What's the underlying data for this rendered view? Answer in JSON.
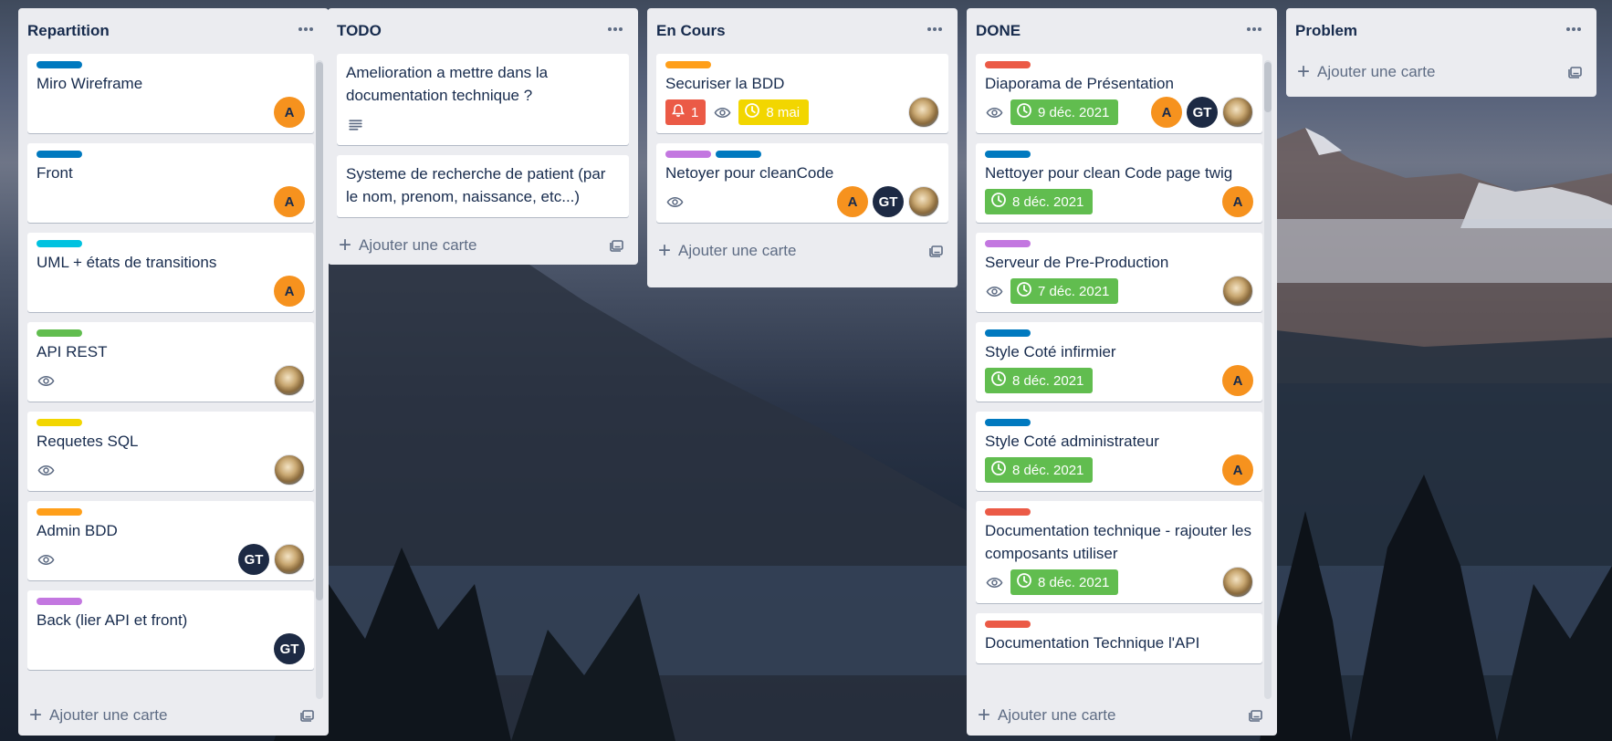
{
  "board": {
    "add_card_label": "Ajouter une carte",
    "lists": [
      {
        "title": "Repartition",
        "cards": [
          {
            "title": "Miro Wireframe",
            "labels": [
              "#0079bf"
            ],
            "members": [
              "A"
            ]
          },
          {
            "title": "Front",
            "labels": [
              "#0079bf"
            ],
            "members": [
              "A"
            ]
          },
          {
            "title": "UML + états de transitions",
            "labels": [
              "#00c2e0"
            ],
            "members": [
              "A"
            ]
          },
          {
            "title": "API REST",
            "labels": [
              "#61bd4f"
            ],
            "watch": true,
            "members": [
              "photo"
            ]
          },
          {
            "title": "Requetes SQL",
            "labels": [
              "#f2d600"
            ],
            "watch": true,
            "members": [
              "photo"
            ]
          },
          {
            "title": "Admin BDD",
            "labels": [
              "#ff9f1a"
            ],
            "watch": true,
            "members": [
              "GT",
              "photo"
            ]
          },
          {
            "title": "Back (lier API et front)",
            "labels": [
              "#c377e0"
            ],
            "members": [
              "GT"
            ]
          }
        ]
      },
      {
        "title": "TODO",
        "cards": [
          {
            "title": "Amelioration a mettre dans la documentation technique ?",
            "description": true
          },
          {
            "title": "Systeme de recherche de patient (par le nom, prenom, naissance, etc...)"
          }
        ]
      },
      {
        "title": "En Cours",
        "cards": [
          {
            "title": "Securiser la BDD",
            "labels": [
              "#ff9f1a"
            ],
            "alert": "1",
            "watch": true,
            "due": "8 mai",
            "members": [
              "photo"
            ]
          },
          {
            "title": "Netoyer pour cleanCode",
            "labels": [
              "#c377e0",
              "#0079bf"
            ],
            "watch": true,
            "members": [
              "A",
              "GT",
              "photo"
            ]
          }
        ]
      },
      {
        "title": "DONE",
        "cards": [
          {
            "title": "Diaporama de Présentation",
            "labels": [
              "#eb5a46"
            ],
            "watch": true,
            "due": "9 déc. 2021",
            "members": [
              "A",
              "GT",
              "photo"
            ]
          },
          {
            "title": "Nettoyer pour clean Code page twig",
            "labels": [
              "#0079bf"
            ],
            "due": "8 déc. 2021",
            "members": [
              "A"
            ]
          },
          {
            "title": "Serveur de Pre-Production",
            "labels": [
              "#c377e0"
            ],
            "watch": true,
            "due": "7 déc. 2021",
            "members": [
              "photo"
            ]
          },
          {
            "title": "Style Coté infirmier",
            "labels": [
              "#0079bf"
            ],
            "due": "8 déc. 2021",
            "members": [
              "A"
            ]
          },
          {
            "title": "Style Coté administrateur",
            "labels": [
              "#0079bf"
            ],
            "due": "8 déc. 2021",
            "members": [
              "A"
            ]
          },
          {
            "title": "Documentation technique - rajouter les composants utiliser",
            "labels": [
              "#eb5a46"
            ],
            "watch": true,
            "due": "8 déc. 2021",
            "members": [
              "photo"
            ]
          },
          {
            "title": "Documentation Technique l'API",
            "labels": [
              "#eb5a46"
            ]
          }
        ]
      },
      {
        "title": "Problem",
        "cards": []
      }
    ]
  }
}
